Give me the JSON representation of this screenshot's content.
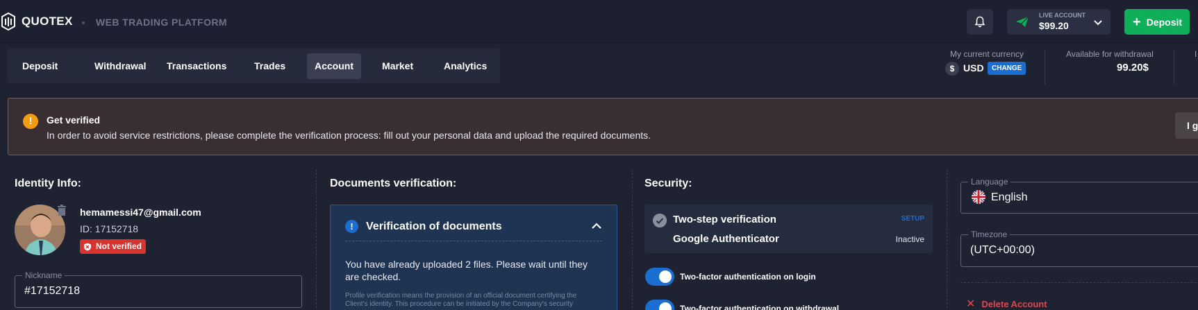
{
  "header": {
    "brand": "QUOTEX",
    "subtitle": "WEB TRADING PLATFORM",
    "account_type": "LIVE ACCOUNT",
    "account_balance": "$99.20",
    "deposit_label": "Deposit"
  },
  "tabs": [
    {
      "label": "Deposit"
    },
    {
      "label": "Withdrawal"
    },
    {
      "label": "Transactions"
    },
    {
      "label": "Trades"
    },
    {
      "label": "Account",
      "active": true
    },
    {
      "label": "Market"
    },
    {
      "label": "Analytics"
    }
  ],
  "currency": {
    "label": "My current currency",
    "sign": "$",
    "code": "USD",
    "change_label": "CHANGE"
  },
  "withdrawal": {
    "label": "Available for withdrawal",
    "value": "99.20$"
  },
  "cut_label": "I",
  "banner": {
    "title": "Get verified",
    "text": "In order to avoid service restrictions, please complete the verification process: fill out your personal data and upload the required documents.",
    "button_label": "I g"
  },
  "identity": {
    "title": "Identity Info:",
    "email": "hemamessi47@gmail.com",
    "id": "ID: 17152718",
    "status": "Not verified",
    "nickname_label": "Nickname",
    "nickname_value": "#17152718"
  },
  "documents": {
    "title": "Documents verification:",
    "box_title": "Verification of documents",
    "message": "You have already uploaded 2 files. Please wait until they are checked.",
    "fine_print": "Profile verification means the provision of an official document certifying the Client's identity. This procedure can be initiated by the Company's security"
  },
  "security": {
    "title": "Security:",
    "two_step_title": "Two-step verification",
    "setup_label": "SETUP",
    "method": "Google Authenticator",
    "status": "Inactive",
    "toggle_login": "Two-factor authentication on login",
    "toggle_withdrawal": "Two-factor authentication on withdrawal"
  },
  "settings": {
    "language_label": "Language",
    "language_value": "English",
    "timezone_label": "Timezone",
    "timezone_value": "(UTC+00:00)",
    "delete_label": "Delete Account"
  },
  "colors": {
    "background": "#1e2231",
    "accent_green": "#0faf59",
    "accent_blue": "#1a6ed1",
    "warning": "#f39c12",
    "danger": "#d8342f"
  },
  "icons": [
    "logo-icon",
    "bell-icon",
    "paper-plane-icon",
    "chevron-down-icon",
    "plus-icon",
    "exclamation-icon",
    "trash-icon",
    "shield-x-icon",
    "chevron-up-icon",
    "check-icon",
    "uk-flag-icon",
    "close-icon"
  ]
}
